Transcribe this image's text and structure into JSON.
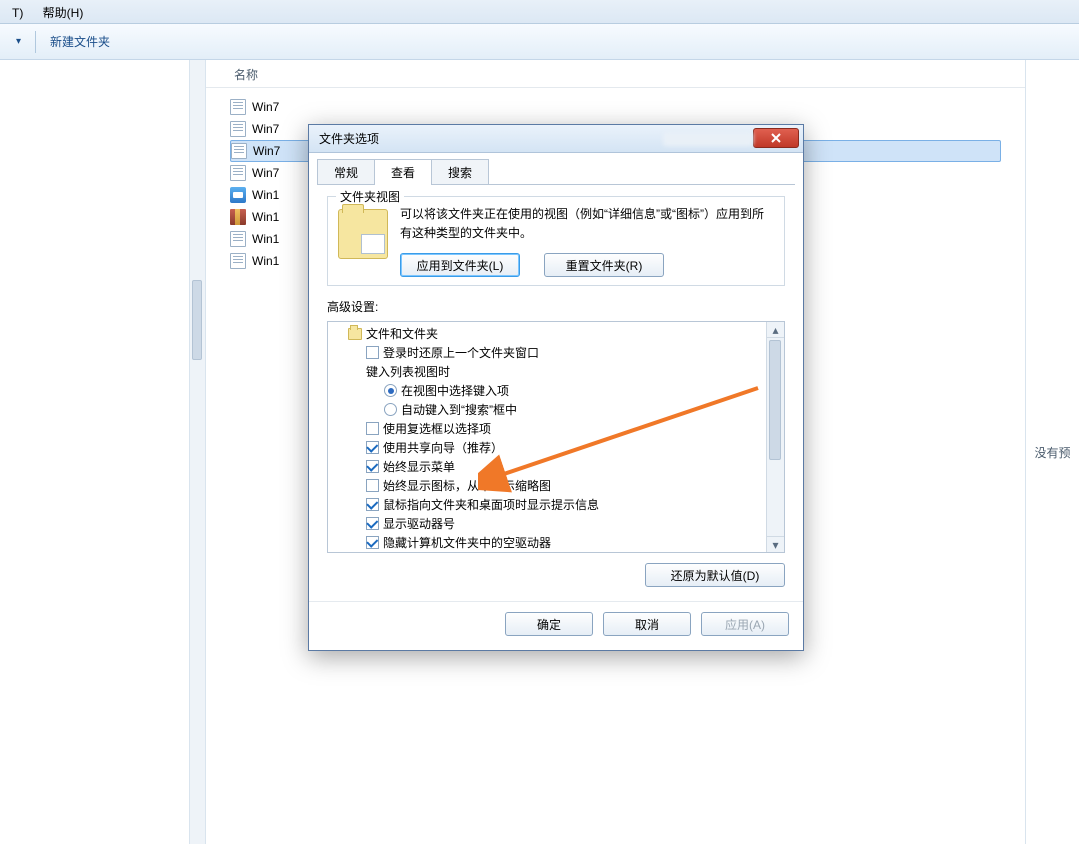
{
  "menubar": {
    "items": [
      "T)",
      "帮助(H)"
    ]
  },
  "toolbar": {
    "organize_chevron": "▾",
    "new_folder": "新建文件夹"
  },
  "list": {
    "header_name": "名称",
    "rows": [
      {
        "icon": "txt",
        "label": "Win7"
      },
      {
        "icon": "txt",
        "label": "Win7"
      },
      {
        "icon": "txt",
        "label": "Win7",
        "selected": true
      },
      {
        "icon": "txt",
        "label": "Win7"
      },
      {
        "icon": "app",
        "label": "Win1"
      },
      {
        "icon": "rar",
        "label": "Win1"
      },
      {
        "icon": "txt",
        "label": "Win1"
      },
      {
        "icon": "txt",
        "label": "Win1"
      }
    ]
  },
  "preview": {
    "no_preview": "没有预"
  },
  "dialog": {
    "title": "文件夹选项",
    "tabs": {
      "general": "常规",
      "view": "查看",
      "search": "搜索"
    },
    "folder_views": {
      "legend": "文件夹视图",
      "desc": "可以将该文件夹正在使用的视图（例如“详细信息”或“图标”）应用到所有这种类型的文件夹中。",
      "apply_btn": "应用到文件夹(L)",
      "reset_btn": "重置文件夹(R)"
    },
    "advanced_label": "高级设置:",
    "tree": {
      "root": "文件和文件夹",
      "items": [
        {
          "type": "cb",
          "checked": false,
          "label": "登录时还原上一个文件夹窗口",
          "indent": 2
        },
        {
          "type": "text",
          "label": "键入列表视图时",
          "indent": 2
        },
        {
          "type": "rb",
          "checked": true,
          "label": "在视图中选择键入项",
          "indent": 3
        },
        {
          "type": "rb",
          "checked": false,
          "label": "自动键入到“搜索”框中",
          "indent": 3
        },
        {
          "type": "cb",
          "checked": false,
          "label": "使用复选框以选择项",
          "indent": 2
        },
        {
          "type": "cb",
          "checked": true,
          "label": "使用共享向导（推荐）",
          "indent": 2
        },
        {
          "type": "cb",
          "checked": true,
          "label": "始终显示菜单",
          "indent": 2
        },
        {
          "type": "cb",
          "checked": false,
          "label": "始终显示图标，从不显示缩略图",
          "indent": 2
        },
        {
          "type": "cb",
          "checked": true,
          "label": "鼠标指向文件夹和桌面项时显示提示信息",
          "indent": 2
        },
        {
          "type": "cb",
          "checked": true,
          "label": "显示驱动器号",
          "indent": 2
        },
        {
          "type": "cb",
          "checked": true,
          "label": "隐藏计算机文件夹中的空驱动器",
          "indent": 2
        }
      ]
    },
    "restore_defaults": "还原为默认值(D)",
    "ok": "确定",
    "cancel": "取消",
    "apply": "应用(A)"
  }
}
